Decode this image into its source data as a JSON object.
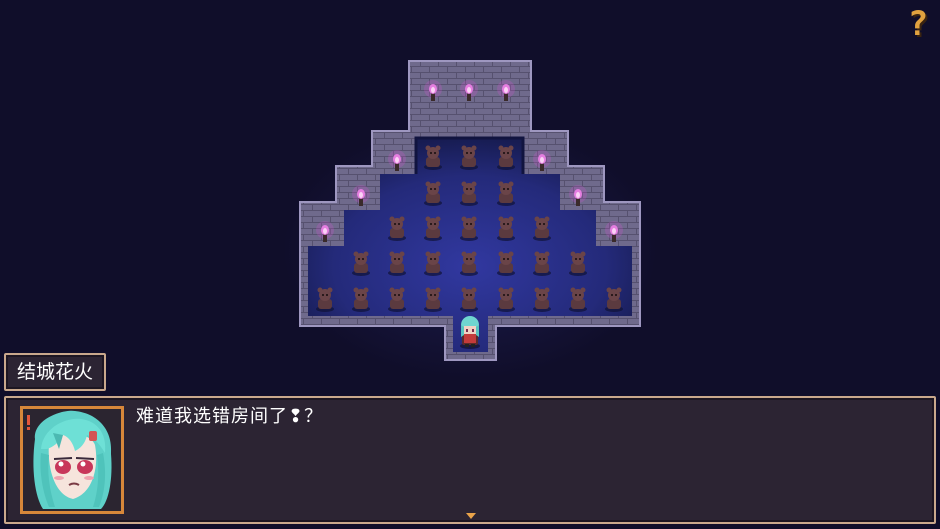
{
  "hud": {
    "help_label": "?"
  },
  "dialogue": {
    "speaker": "结城花火",
    "message": "难道我选错房间了❢？"
  },
  "icons": {
    "help": "question-mark-icon",
    "continue": "down-triangle-icon"
  },
  "colors": {
    "background": "#100e2a",
    "window_fill": "#2c2433",
    "window_border": "#c9a88c",
    "accent": "#e1a23f",
    "floor": "#2c2f86",
    "wall": "#6d6888",
    "torch_flame": "#d155d0"
  }
}
